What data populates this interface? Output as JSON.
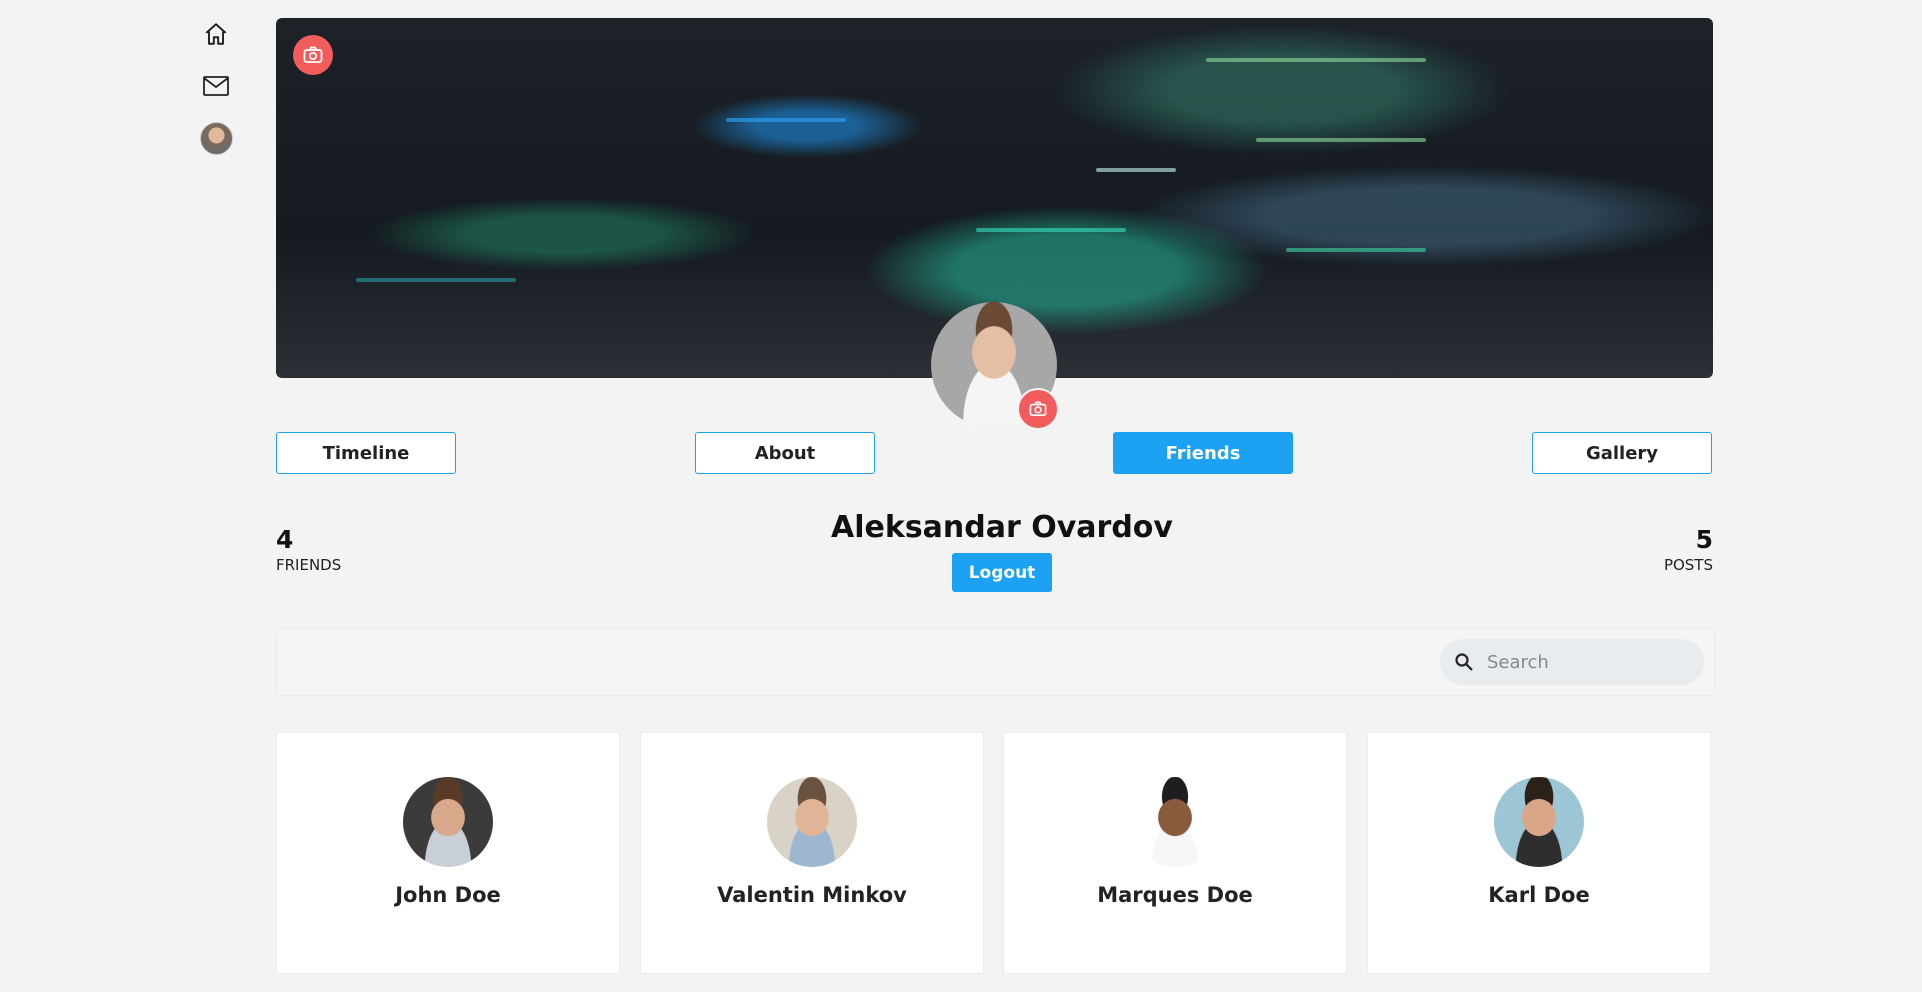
{
  "sidebar": {
    "items": [
      {
        "icon": "home-icon"
      },
      {
        "icon": "mail-icon"
      },
      {
        "icon": "avatar"
      }
    ]
  },
  "tabs": [
    {
      "label": "Timeline",
      "active": false
    },
    {
      "label": "About",
      "active": false
    },
    {
      "label": "Friends",
      "active": true
    },
    {
      "label": "Gallery",
      "active": false
    }
  ],
  "profile": {
    "name": "Aleksandar Ovardov",
    "logout_label": "Logout",
    "friends_count": "4",
    "friends_label": "FRIENDS",
    "posts_count": "5",
    "posts_label": "POSTS"
  },
  "search": {
    "placeholder": "Search",
    "value": ""
  },
  "friends": [
    {
      "name": "John Doe"
    },
    {
      "name": "Valentin Minkov"
    },
    {
      "name": "Marques Doe"
    },
    {
      "name": "Karl Doe"
    }
  ],
  "colors": {
    "accent": "#1da1f2",
    "camera_button": "#f25c5c",
    "background": "#f3f3f3"
  }
}
